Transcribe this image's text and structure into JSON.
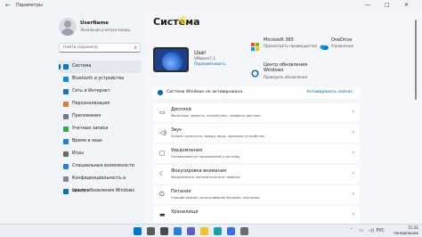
{
  "window": {
    "title": "Параметры"
  },
  "user": {
    "name": "UserName",
    "subtitle": "Локальная учетная запись"
  },
  "search": {
    "placeholder": "Найти параметр"
  },
  "sidebar": {
    "items": [
      {
        "label": "Система",
        "color": "#0078d4",
        "active": true
      },
      {
        "label": "Bluetooth и устройства",
        "color": "#0a8ae0"
      },
      {
        "label": "Сеть и Интернет",
        "color": "#1f6fc0"
      },
      {
        "label": "Персонализация",
        "color": "#e8772e"
      },
      {
        "label": "Приложения",
        "color": "#6b7b8c"
      },
      {
        "label": "Учетные записи",
        "color": "#2fa84f"
      },
      {
        "label": "Время и язык",
        "color": "#1f7fd1"
      },
      {
        "label": "Игры",
        "color": "#6b6b6b"
      },
      {
        "label": "Специальные возможности",
        "color": "#2c7bd9"
      },
      {
        "label": "Конфиденциальность и защита",
        "color": "#7b8a99"
      },
      {
        "label": "Центр обновления Windows",
        "color": "#0f6cbd"
      }
    ]
  },
  "main": {
    "title": "Система",
    "device": {
      "name": "User",
      "model": "VMware7,1",
      "rename": "Переименовать"
    },
    "tiles": [
      {
        "title": "Microsoft 365",
        "subtitle": "Просмотреть преимущества",
        "icon": "microsoft-365-icon",
        "color": "#d83b01"
      },
      {
        "title": "OneDrive",
        "subtitle": "Управление",
        "icon": "onedrive-icon",
        "color": "#0078d4"
      },
      {
        "title": "Центр обновления Windows",
        "subtitle": "Проверить обновления",
        "icon": "windows-update-icon",
        "color": "#0067c0"
      }
    ],
    "activation": {
      "text": "Система Windows не активирована.",
      "action": "Активировать сейчас"
    },
    "settings": [
      {
        "title": "Дисплей",
        "subtitle": "Мониторы, яркость, ночной свет, профиль дисплея",
        "icon": "display-icon",
        "glyph": "▭"
      },
      {
        "title": "Звук",
        "subtitle": "Уровни громкости, вывод, ввод, звуковые устройства",
        "icon": "sound-icon",
        "glyph": "◁)"
      },
      {
        "title": "Уведомления",
        "subtitle": "Оповещения от приложений и системы",
        "icon": "notifications-icon",
        "glyph": "▢"
      },
      {
        "title": "Фокусировка внимания",
        "subtitle": "Уведомления, автоматические правила",
        "icon": "focus-assist-icon",
        "glyph": "☾"
      },
      {
        "title": "Питание",
        "subtitle": "Спящий режим, использование батареи, экономия",
        "icon": "power-icon",
        "glyph": "⏻"
      },
      {
        "title": "Хранилище",
        "subtitle": "",
        "icon": "storage-icon",
        "glyph": "▬"
      }
    ]
  },
  "taskbar": {
    "apps": [
      {
        "name": "start",
        "color": "#0078d4"
      },
      {
        "name": "search",
        "color": "#5a5a5a"
      },
      {
        "name": "task-view",
        "color": "#4a4a4a"
      },
      {
        "name": "widgets",
        "color": "#2a7fd8"
      },
      {
        "name": "chat",
        "color": "#5b5fc7"
      },
      {
        "name": "file-explorer",
        "color": "#f3c12c"
      },
      {
        "name": "edge",
        "color": "#18a0a8"
      },
      {
        "name": "store",
        "color": "#3a6ee8"
      },
      {
        "name": "settings",
        "color": "#6b6b6b"
      }
    ],
    "time": "15:31",
    "date": "понедельник"
  }
}
